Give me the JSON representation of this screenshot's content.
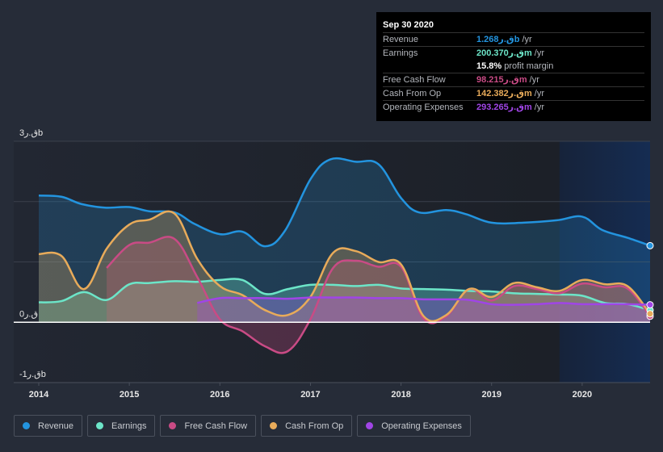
{
  "tooltip": {
    "date": "Sep 30 2020",
    "rows": [
      {
        "label": "Revenue",
        "value": "1.268ق.رb",
        "unit": "/yr",
        "color": "#2394df"
      },
      {
        "label": "Earnings",
        "value": "200.370ق.رm",
        "unit": "/yr",
        "color": "#6ce5c8"
      },
      {
        "label": "",
        "value": "15.8%",
        "unit": "profit margin",
        "color": "#ffffff"
      },
      {
        "label": "Free Cash Flow",
        "value": "98.215ق.رm",
        "unit": "/yr",
        "color": "#c94b85"
      },
      {
        "label": "Cash From Op",
        "value": "142.382ق.رm",
        "unit": "/yr",
        "color": "#e8ab5a"
      },
      {
        "label": "Operating Expenses",
        "value": "293.265ق.رm",
        "unit": "/yr",
        "color": "#a045e6"
      }
    ]
  },
  "legend": [
    {
      "label": "Revenue",
      "color": "#2394df"
    },
    {
      "label": "Earnings",
      "color": "#6ce5c8"
    },
    {
      "label": "Free Cash Flow",
      "color": "#c94b85"
    },
    {
      "label": "Cash From Op",
      "color": "#e8ab5a"
    },
    {
      "label": "Operating Expenses",
      "color": "#a045e6"
    }
  ],
  "chart_data": {
    "type": "area",
    "title": "",
    "xlabel": "",
    "ylabel": "",
    "ylim": [
      -1,
      3
    ],
    "xlim": [
      2014,
      2020.75
    ],
    "y_tick_labels": [
      {
        "value": 3,
        "label": "3ق.رb"
      },
      {
        "value": 0,
        "label": "0ق.ر"
      },
      {
        "value": -1,
        "label": "-1ق.رb"
      }
    ],
    "x_tick_labels": [
      "2014",
      "2015",
      "2016",
      "2017",
      "2018",
      "2019",
      "2020"
    ],
    "x_ticks": [
      2014,
      2015,
      2016,
      2017,
      2018,
      2019,
      2020
    ],
    "gridlines": [
      3,
      2,
      1,
      0
    ],
    "highlight_start": 2019.75,
    "series": [
      {
        "name": "Revenue",
        "color": "#2394df",
        "x": [
          2014,
          2014.25,
          2014.47,
          2014.73,
          2015,
          2015.22,
          2015.5,
          2015.72,
          2016,
          2016.25,
          2016.5,
          2016.72,
          2017,
          2017.22,
          2017.5,
          2017.75,
          2018,
          2018.2,
          2018.5,
          2018.72,
          2019,
          2019.35,
          2019.72,
          2020,
          2020.22,
          2020.5,
          2020.75
        ],
        "values": [
          2.1,
          2.08,
          1.96,
          1.9,
          1.91,
          1.84,
          1.82,
          1.63,
          1.46,
          1.5,
          1.26,
          1.52,
          2.37,
          2.7,
          2.66,
          2.62,
          2.06,
          1.82,
          1.86,
          1.79,
          1.65,
          1.65,
          1.69,
          1.75,
          1.53,
          1.4,
          1.27
        ]
      },
      {
        "name": "Earnings",
        "color": "#6ce5c8",
        "x": [
          2014,
          2014.25,
          2014.5,
          2014.75,
          2015,
          2015.22,
          2015.5,
          2015.75,
          2016,
          2016.25,
          2016.5,
          2016.75,
          2017,
          2017.25,
          2017.5,
          2017.75,
          2018,
          2018.25,
          2018.5,
          2018.75,
          2019,
          2019.25,
          2019.5,
          2019.75,
          2020,
          2020.25,
          2020.5,
          2020.75
        ],
        "values": [
          0.33,
          0.35,
          0.5,
          0.37,
          0.63,
          0.65,
          0.68,
          0.67,
          0.7,
          0.7,
          0.47,
          0.55,
          0.62,
          0.62,
          0.6,
          0.62,
          0.56,
          0.55,
          0.54,
          0.52,
          0.51,
          0.48,
          0.47,
          0.46,
          0.44,
          0.32,
          0.3,
          0.2
        ]
      },
      {
        "name": "Free Cash Flow",
        "color": "#c94b85",
        "x": [
          2014.75,
          2015,
          2015.22,
          2015.5,
          2015.75,
          2016,
          2016.25,
          2016.5,
          2016.75,
          2017,
          2017.25,
          2017.5,
          2017.75,
          2018,
          2018.25,
          2018.5,
          2018.75,
          2019,
          2019.25,
          2019.5,
          2019.75,
          2020,
          2020.25,
          2020.5,
          2020.75
        ],
        "values": [
          0.9,
          1.28,
          1.32,
          1.38,
          0.75,
          0.05,
          -0.15,
          -0.4,
          -0.48,
          0.05,
          0.9,
          1.02,
          0.92,
          0.92,
          0.06,
          0.1,
          0.55,
          0.36,
          0.6,
          0.55,
          0.48,
          0.64,
          0.58,
          0.56,
          0.1
        ]
      },
      {
        "name": "Cash From Op",
        "color": "#e8ab5a",
        "x": [
          2014,
          2014.25,
          2014.5,
          2014.75,
          2015,
          2015.22,
          2015.5,
          2015.75,
          2016,
          2016.25,
          2016.5,
          2016.75,
          2017,
          2017.25,
          2017.5,
          2017.75,
          2018,
          2018.25,
          2018.5,
          2018.75,
          2019,
          2019.25,
          2019.5,
          2019.75,
          2020,
          2020.25,
          2020.5,
          2020.75
        ],
        "values": [
          1.13,
          1.1,
          0.55,
          1.22,
          1.62,
          1.7,
          1.8,
          1.05,
          0.6,
          0.45,
          0.2,
          0.12,
          0.42,
          1.15,
          1.18,
          1.0,
          0.96,
          0.1,
          0.12,
          0.55,
          0.42,
          0.65,
          0.58,
          0.52,
          0.7,
          0.63,
          0.6,
          0.14
        ]
      },
      {
        "name": "Operating Expenses",
        "color": "#a045e6",
        "x": [
          2015.75,
          2016,
          2016.25,
          2016.5,
          2016.75,
          2017,
          2017.25,
          2017.5,
          2017.75,
          2018,
          2018.25,
          2018.5,
          2018.75,
          2019,
          2019.25,
          2019.5,
          2019.75,
          2020,
          2020.25,
          2020.5,
          2020.75
        ],
        "values": [
          0.32,
          0.4,
          0.4,
          0.4,
          0.39,
          0.41,
          0.41,
          0.41,
          0.4,
          0.4,
          0.38,
          0.38,
          0.37,
          0.3,
          0.29,
          0.3,
          0.32,
          0.3,
          0.3,
          0.3,
          0.29
        ]
      }
    ]
  }
}
